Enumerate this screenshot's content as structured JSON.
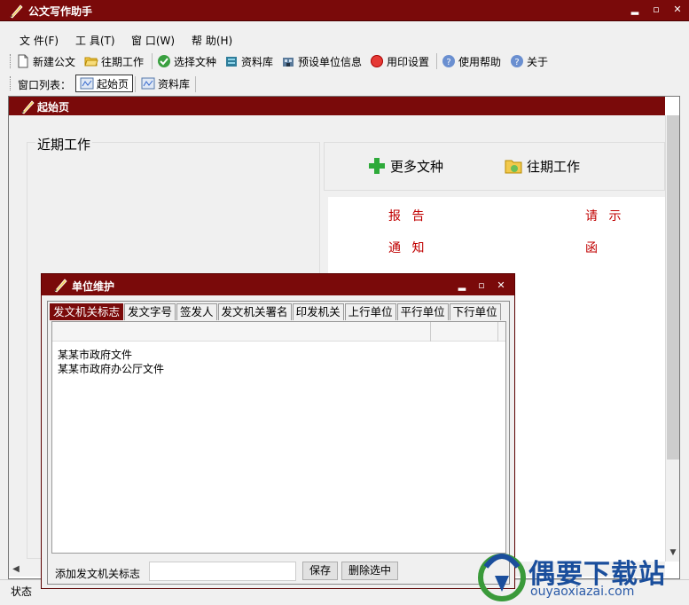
{
  "window": {
    "title": "公文写作助手",
    "buttons": [
      "▂",
      "▫",
      "✕"
    ]
  },
  "menubar": [
    "文 件(F)",
    "工 具(T)",
    "窗 口(W)",
    "帮 助(H)"
  ],
  "toolbar": [
    {
      "label": "新建公文",
      "icon": "new-document-icon"
    },
    {
      "label": "往期工作",
      "icon": "folder-open-icon"
    },
    {
      "label": "选择文种",
      "icon": "select-doctype-icon"
    },
    {
      "label": "资料库",
      "icon": "library-icon"
    },
    {
      "label": "预设单位信息",
      "icon": "unit-info-icon"
    },
    {
      "label": "用印设置",
      "icon": "seal-icon"
    },
    {
      "label": "使用帮助",
      "icon": "help-icon"
    },
    {
      "label": "关于",
      "icon": "about-icon"
    }
  ],
  "window_list": {
    "label": "窗口列表：",
    "tabs": [
      {
        "label": "起始页",
        "active": true
      },
      {
        "label": "资料库",
        "active": false
      }
    ]
  },
  "start_page": {
    "title": "起始页",
    "recent_label": "近期工作",
    "quick_links": [
      "更多文种",
      "往期工作"
    ],
    "doc_types": [
      "报 告",
      "请 示",
      "通 知",
      "函"
    ]
  },
  "dialog": {
    "title": "单位维护",
    "tabs": [
      "发文机关标志",
      "发文字号",
      "签发人",
      "发文机关署名",
      "印发机关",
      "上行单位",
      "平行单位",
      "下行单位"
    ],
    "active_tab": 0,
    "items": [
      "某某市政府文件",
      "某某市政府办公厅文件"
    ],
    "add_label": "添加发文机关标志",
    "add_value": "",
    "save_button": "保存",
    "delete_button": "删除选中"
  },
  "status": "状态",
  "watermark": {
    "title": "偶要下载站",
    "url": "ouyaoxiazai.com"
  },
  "colors": {
    "title_bg": "#7a0a0a",
    "doc_link": "#c00000",
    "watermark": "#1a4e9c"
  }
}
